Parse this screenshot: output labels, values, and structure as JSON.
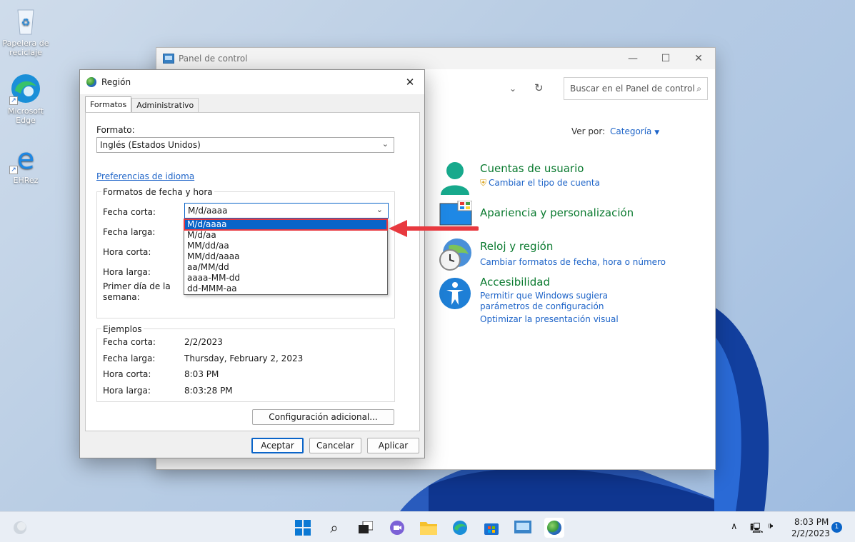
{
  "desktop": {
    "icons": [
      {
        "label": "Papelera de reciclaje"
      },
      {
        "label": "Microsoft Edge"
      },
      {
        "label": "EHRez"
      }
    ]
  },
  "control_panel": {
    "title": "Panel de control",
    "controls": {
      "minimize": "—",
      "maximize": "☐",
      "close": "✕"
    },
    "search_placeholder": "Buscar en el Panel de control",
    "view_by_label": "Ver por:",
    "view_by_value": "Categoría",
    "categories": [
      {
        "title": "Cuentas de usuario",
        "links": [
          "Cambiar el tipo de cuenta"
        ]
      },
      {
        "title": "Apariencia y personalización",
        "links": []
      },
      {
        "title": "Reloj y región",
        "links": [
          "Cambiar formatos de fecha, hora o número"
        ]
      },
      {
        "title": "Accesibilidad",
        "links": [
          "Permitir que Windows sugiera parámetros de configuración",
          "Optimizar la presentación visual"
        ]
      }
    ]
  },
  "region_dialog": {
    "title": "Región",
    "close": "✕",
    "tabs": [
      "Formatos",
      "Administrativo"
    ],
    "format_label": "Formato:",
    "format_value": "Inglés (Estados Unidos)",
    "language_prefs_link": "Preferencias de idioma",
    "date_time_group": "Formatos de fecha y hora",
    "short_date_label": "Fecha corta:",
    "short_date_value": "M/d/aaaa",
    "long_date_label": "Fecha larga:",
    "short_time_label": "Hora corta:",
    "long_time_label": "Hora larga:",
    "first_day_label_1": "Primer día de la",
    "first_day_label_2": "semana:",
    "dropdown_options": [
      "M/d/aaaa",
      "M/d/aa",
      "MM/dd/aa",
      "MM/dd/aaaa",
      "aa/MM/dd",
      "aaaa-MM-dd",
      "dd-MMM-aa"
    ],
    "examples_group": "Ejemplos",
    "examples": [
      {
        "label": "Fecha corta:",
        "value": "2/2/2023"
      },
      {
        "label": "Fecha larga:",
        "value": "Thursday, February 2, 2023"
      },
      {
        "label": "Hora corta:",
        "value": "8:03 PM"
      },
      {
        "label": "Hora larga:",
        "value": "8:03:28 PM"
      }
    ],
    "additional_settings_button": "Configuración adicional...",
    "ok_button": "Aceptar",
    "cancel_button": "Cancelar",
    "apply_button": "Aplicar"
  },
  "taskbar": {
    "time": "8:03 PM",
    "date": "2/2/2023",
    "notification_count": "1"
  },
  "colors": {
    "accent": "#0a64c8",
    "highlight_red": "#e8393f",
    "category_green": "#0a7a2f",
    "link_blue": "#1e64c8"
  }
}
